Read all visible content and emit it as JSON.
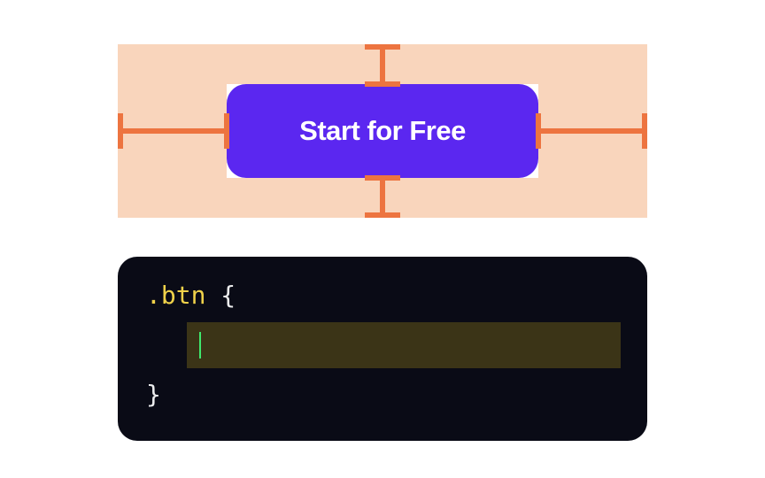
{
  "diagram": {
    "button_label": "Start for Free"
  },
  "editor": {
    "selector": ".btn",
    "open_brace": "{",
    "close_brace": "}",
    "input_value": ""
  }
}
